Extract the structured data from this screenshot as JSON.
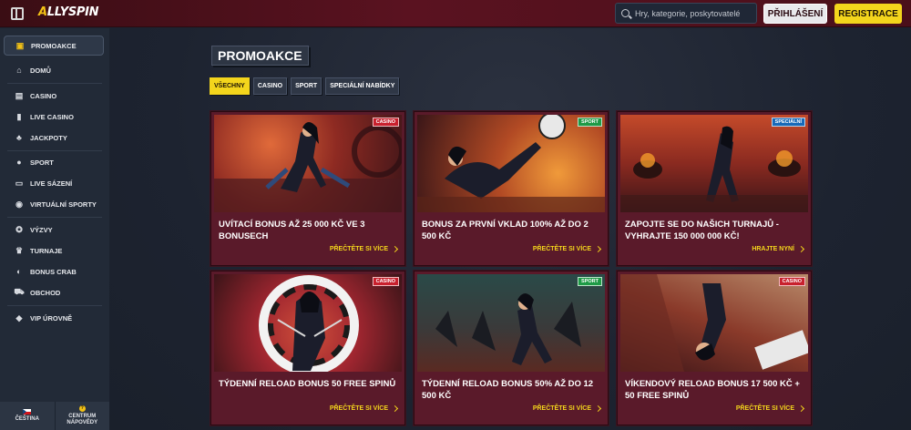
{
  "header": {
    "logo_mark": "A",
    "logo_text": "ALLYSPIN",
    "search_placeholder": "Hry, kategorie, poskytovatelé",
    "login_label": "PŘIHLÁŠENÍ",
    "register_label": "REGISTRACE"
  },
  "sidebar": {
    "items": [
      {
        "label": "PROMOAKCE",
        "icon": "gift-icon",
        "glyph": "▣"
      },
      {
        "label": "DOMŮ",
        "icon": "home-icon",
        "glyph": "⌂"
      },
      {
        "label": "CASINO",
        "icon": "slot-machine-icon",
        "glyph": "▤"
      },
      {
        "label": "LIVE CASINO",
        "icon": "cards-icon",
        "glyph": "▮"
      },
      {
        "label": "JACKPOTY",
        "icon": "clover-icon",
        "glyph": "♣"
      },
      {
        "label": "SPORT",
        "icon": "ball-icon",
        "glyph": "●"
      },
      {
        "label": "LIVE SÁZENÍ",
        "icon": "live-icon",
        "glyph": "▭"
      },
      {
        "label": "VIRTUÁLNÍ SPORTY",
        "icon": "virtual-icon",
        "glyph": "◉"
      },
      {
        "label": "VÝZVY",
        "icon": "challenge-icon",
        "glyph": "✪"
      },
      {
        "label": "TURNAJE",
        "icon": "trophy-icon",
        "glyph": "♛"
      },
      {
        "label": "BONUS CRAB",
        "icon": "crab-icon",
        "glyph": "◐"
      },
      {
        "label": "OBCHOD",
        "icon": "cart-icon",
        "glyph": "⛟"
      },
      {
        "label": "VIP ÚROVNĚ",
        "icon": "diamond-icon",
        "glyph": "◆"
      }
    ],
    "language": "ČEŠTINA",
    "help_line1": "CENTRUM",
    "help_line2": "NÁPOVĚDY"
  },
  "main": {
    "title": "PROMOAKCE",
    "tabs": [
      "VŠECHNY",
      "CASINO",
      "SPORT",
      "SPECIÁLNÍ NABÍDKY"
    ],
    "cards": [
      {
        "badge": "CASINO",
        "badge_type": "casino",
        "title": "UVÍTACÍ BONUS AŽ 25 000 KČ VE 3 BONUSECH",
        "cta": "PŘEČTĚTE SI VÍCE"
      },
      {
        "badge": "SPORT",
        "badge_type": "sport",
        "title": "BONUS ZA PRVNÍ VKLAD 100% AŽ DO 2 500 KČ",
        "cta": "PŘEČTĚTE SI VÍCE"
      },
      {
        "badge": "SPECIÁLNÍ",
        "badge_type": "special",
        "title": "ZAPOJTE SE DO NAŠICH TURNAJŮ - VYHRAJTE 150 000 000 KČ!",
        "cta": "HRAJTE NYNÍ"
      },
      {
        "badge": "CASINO",
        "badge_type": "casino",
        "title": "TÝDENNÍ RELOAD BONUS 50 FREE SPINŮ",
        "cta": "PŘEČTĚTE SI VÍCE"
      },
      {
        "badge": "SPORT",
        "badge_type": "sport",
        "title": "TÝDENNÍ RELOAD BONUS 50% AŽ DO 12 500 KČ",
        "cta": "PŘEČTĚTE SI VÍCE"
      },
      {
        "badge": "CASINO",
        "badge_type": "casino",
        "title": "VÍKENDOVÝ RELOAD BONUS 17 500 KČ + 50 FREE SPINŮ",
        "cta": "PŘEČTĚTE SI VÍCE"
      }
    ]
  },
  "colors": {
    "accent_yellow": "#f3d51c",
    "header_red": "#5a1220",
    "card_bg": "#5a1a2a",
    "sidebar_bg": "#222a37"
  }
}
